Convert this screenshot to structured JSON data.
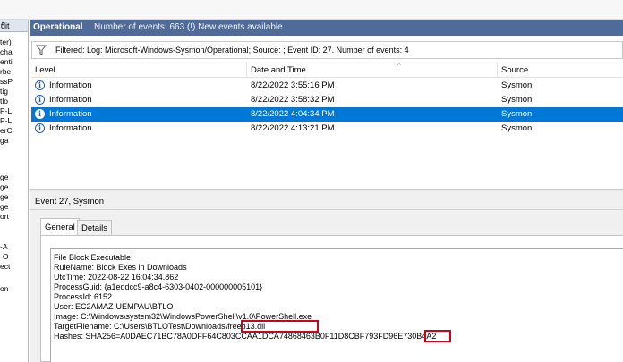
{
  "left_tree": {
    "header": "dit",
    "header_arrow": "^",
    "fragments": [
      "ter)",
      "cha",
      "enti",
      "rbe",
      "ssP",
      "tig",
      "tlo",
      "P-L",
      "P-L",
      "erC",
      "ga",
      "ge",
      "ge",
      "ge",
      "ge",
      "ort",
      "-A",
      "-O",
      "ect",
      "on"
    ]
  },
  "log": {
    "name": "Operational",
    "count_text": "Number of events: 663 (!) New events available"
  },
  "filter": {
    "icon": "funnel-icon",
    "text": "Filtered: Log: Microsoft-Windows-Sysmon/Operational; Source: ; Event ID: 27. Number of events: 4"
  },
  "grid": {
    "columns": [
      "Level",
      "Date and Time",
      "Source"
    ],
    "rows": [
      {
        "level": "Information",
        "datetime": "8/22/2022 3:55:16 PM",
        "source": "Sysmon",
        "selected": false
      },
      {
        "level": "Information",
        "datetime": "8/22/2022 3:58:32 PM",
        "source": "Sysmon",
        "selected": false
      },
      {
        "level": "Information",
        "datetime": "8/22/2022 4:04:34 PM",
        "source": "Sysmon",
        "selected": true
      },
      {
        "level": "Information",
        "datetime": "8/22/2022 4:13:21 PM",
        "source": "Sysmon",
        "selected": false
      }
    ]
  },
  "event": {
    "title": "Event 27, Sysmon",
    "tabs": [
      "General",
      "Details"
    ],
    "details": [
      "File Block Executable:",
      "RuleName: Block Exes in Downloads",
      "UtcTime: 2022-08-22 16:04:34.862",
      "ProcessGuid: {a1eddcc9-a8c4-6303-0402-000000005101}",
      "ProcessId: 6152",
      "User: EC2AMAZ-UEMPAU\\BTLO",
      "Image: C:\\Windows\\system32\\WindowsPowerShell\\v1.0\\PowerShell.exe",
      "TargetFilename: C:\\Users\\BTLOTest\\Downloads\\freeb13.dll",
      "Hashes: SHA256=A0DAEC71BC78A0DFF64C803CCAA1DCA74868463B0F11D8CBF793FD96E730B4A2"
    ]
  },
  "colors": {
    "title_bar": "#4e6b9a",
    "selection": "#0078d7",
    "highlight_box": "#d0021b"
  }
}
